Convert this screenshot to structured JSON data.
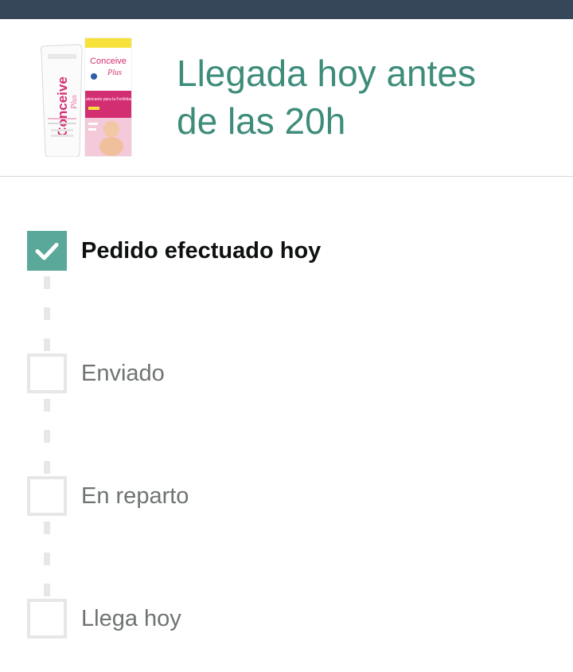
{
  "header": {
    "product_image_icon": "conceive-plus-product-icon",
    "arrival_line1": "Llegada hoy antes",
    "arrival_line2": "de las 20h"
  },
  "product_artwork": {
    "tube_brand": "Conceive",
    "tube_brand_plus": "Plus",
    "box_brand": "Conceive",
    "box_brand_plus": "Plus",
    "box_subtitle": "Lubricante para la Fertilidad"
  },
  "steps": [
    {
      "label": "Pedido efectuado hoy",
      "completed": true
    },
    {
      "label": "Enviado",
      "completed": false
    },
    {
      "label": "En reparto",
      "completed": false
    },
    {
      "label": "Llega hoy",
      "completed": false
    }
  ],
  "colors": {
    "accent": "#5aa899",
    "arrival_text": "#3e8c7b",
    "top_bar": "#37475a",
    "inactive": "#e7e7e7"
  }
}
